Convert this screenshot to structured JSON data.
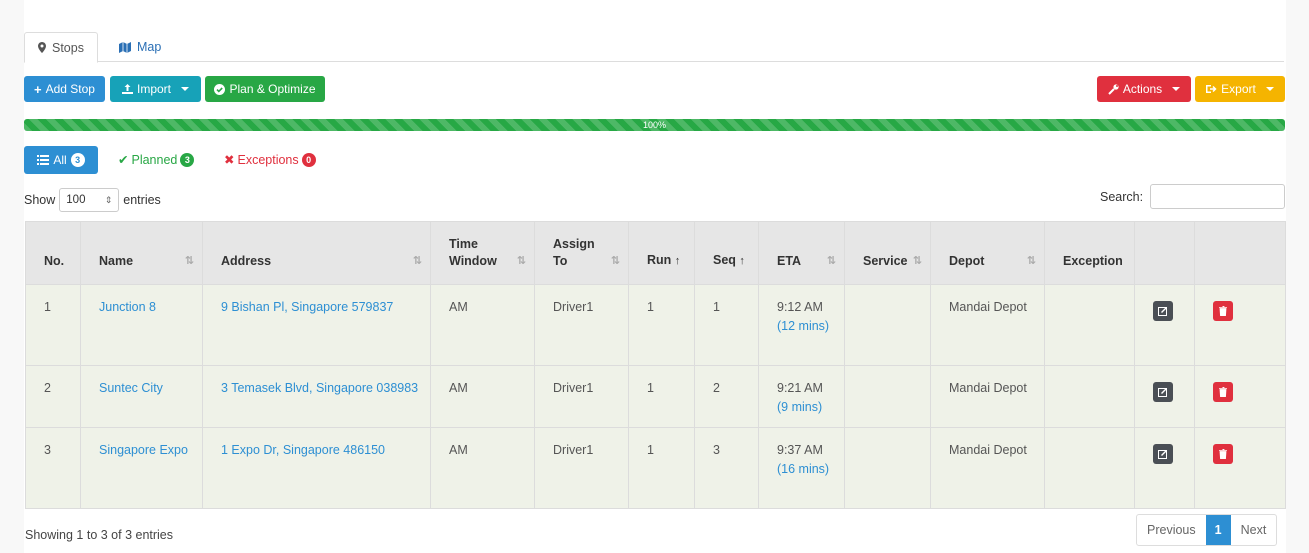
{
  "tabs": [
    {
      "label": "Stops",
      "icon": "map-marker-icon"
    },
    {
      "label": "Map",
      "icon": "map-icon"
    }
  ],
  "toolbar": {
    "add_stop": "Add Stop",
    "import": "Import",
    "plan_optimize": "Plan & Optimize",
    "actions": "Actions",
    "export": "Export"
  },
  "progress": {
    "label": "100%",
    "value": 100
  },
  "filters": {
    "all": {
      "label": "All",
      "count": "3"
    },
    "planned": {
      "label": "Planned",
      "count": "3"
    },
    "exceptions": {
      "label": "Exceptions",
      "count": "0"
    }
  },
  "length": {
    "show": "Show",
    "value": "100",
    "suffix": "entries"
  },
  "search": {
    "label": "Search:",
    "value": ""
  },
  "table": {
    "columns": {
      "no": "No.",
      "name": "Name",
      "address": "Address",
      "time_window_1": "Time",
      "time_window_2": "Window",
      "assign_1": "Assign",
      "assign_2": "To",
      "run": "Run",
      "seq": "Seq",
      "eta": "ETA",
      "service": "Service",
      "depot": "Depot",
      "exception": "Exception"
    },
    "rows": [
      {
        "no": "1",
        "name": "Junction 8",
        "address": "9 Bishan Pl, Singapore 579837",
        "time_window": "AM",
        "assign": "Driver1",
        "run": "1",
        "seq": "1",
        "eta": "9:12 AM",
        "eta_note": "(12 mins)",
        "service": "",
        "depot": "Mandai Depot",
        "exception": ""
      },
      {
        "no": "2",
        "name": "Suntec City",
        "address": "3 Temasek Blvd, Singapore 038983",
        "time_window": "AM",
        "assign": "Driver1",
        "run": "1",
        "seq": "2",
        "eta": "9:21 AM",
        "eta_note": "(9 mins)",
        "service": "",
        "depot": "Mandai Depot",
        "exception": ""
      },
      {
        "no": "3",
        "name": "Singapore Expo",
        "address": "1 Expo Dr, Singapore 486150",
        "time_window": "AM",
        "assign": "Driver1",
        "run": "1",
        "seq": "3",
        "eta": "9:37 AM",
        "eta_note": "(16 mins)",
        "service": "",
        "depot": "Mandai Depot",
        "exception": ""
      }
    ]
  },
  "info": "Showing 1 to 3 of 3 entries",
  "pagination": {
    "previous": "Previous",
    "current": "1",
    "next": "Next"
  },
  "colors": {
    "primary": "#2d8fd3",
    "info": "#17a2b8",
    "success": "#28a745",
    "danger": "#e0303e",
    "warning": "#f5b400"
  }
}
